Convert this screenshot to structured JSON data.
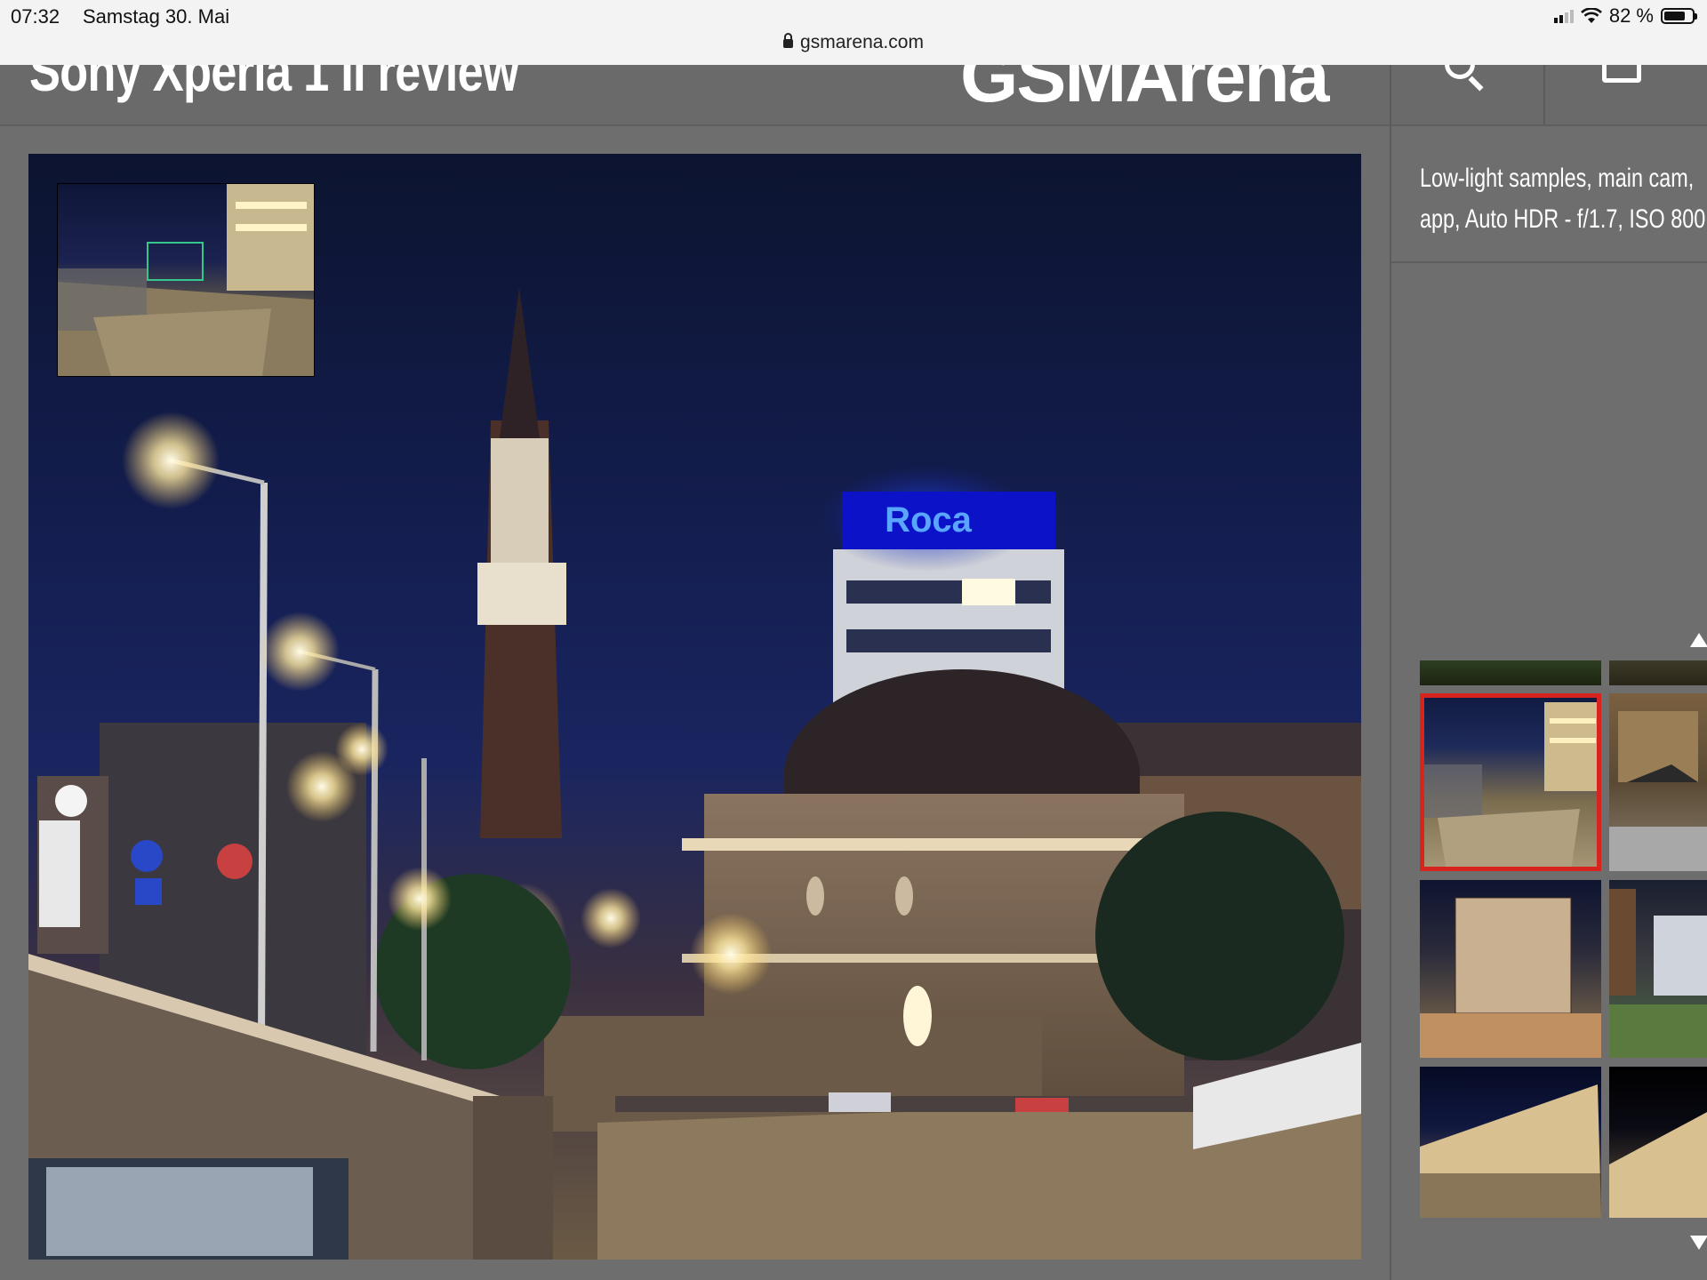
{
  "status_bar": {
    "time": "07:32",
    "date": "Samstag 30. Mai",
    "battery": "82 %",
    "battery_level": 0.82
  },
  "browser": {
    "url": "gsmarena.com"
  },
  "header": {
    "page_title": "Sony Xperia 1 II review",
    "logo": "GSMArena",
    "search_icon": "search-icon",
    "share_icon": "share-icon"
  },
  "photo": {
    "sign_text": "Roca"
  },
  "sidebar": {
    "caption_line1": "Low-light samples, main cam,",
    "caption_line2": "app, Auto HDR - f/1.7, ISO 800",
    "scroll_up_icon": "triangle-up-icon",
    "scroll_down_icon": "triangle-down-icon"
  },
  "colors": {
    "active_thumb": "#d8241e",
    "background": "#6e6e6e",
    "minimap_frame": "#35c68c"
  }
}
